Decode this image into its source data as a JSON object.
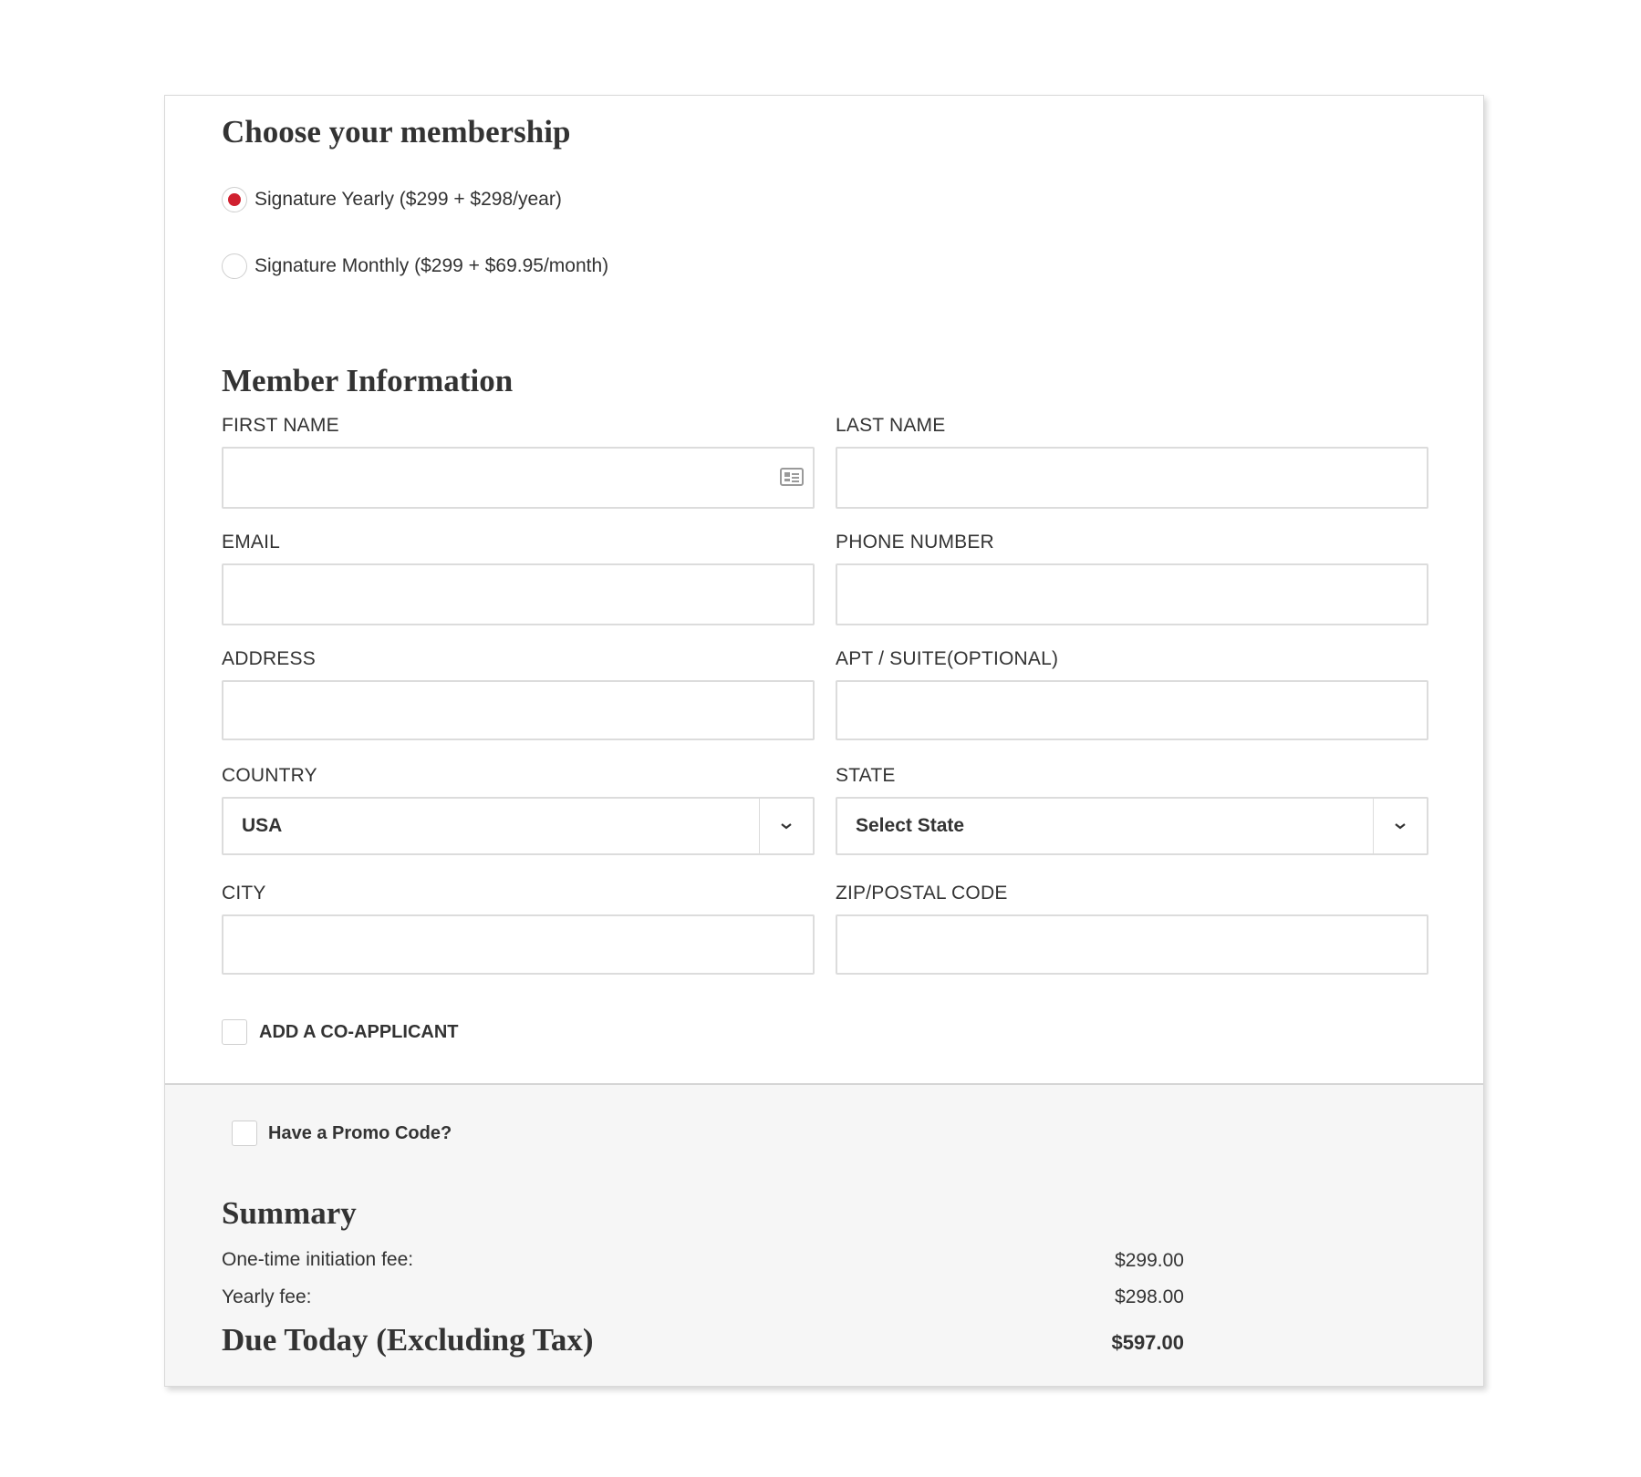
{
  "membership": {
    "heading": "Choose your membership",
    "options": [
      {
        "label": "Signature Yearly ($299 + $298/year)",
        "selected": true
      },
      {
        "label": "Signature Monthly ($299 + $69.95/month)",
        "selected": false
      }
    ],
    "accent_color": "#d0202f"
  },
  "member_info": {
    "heading": "Member Information",
    "first_name": {
      "label": "FIRST NAME",
      "value": ""
    },
    "last_name": {
      "label": "LAST NAME",
      "value": ""
    },
    "email": {
      "label": "EMAIL",
      "value": ""
    },
    "phone": {
      "label": "PHONE NUMBER",
      "value": ""
    },
    "address": {
      "label": "ADDRESS",
      "value": ""
    },
    "apt": {
      "label": "APT / SUITE(OPTIONAL)",
      "value": ""
    },
    "country": {
      "label": "COUNTRY",
      "selected": "USA"
    },
    "state": {
      "label": "STATE",
      "selected": "Select State"
    },
    "city": {
      "label": "CITY",
      "value": ""
    },
    "zip": {
      "label": "ZIP/POSTAL CODE",
      "value": ""
    },
    "co_applicant": {
      "label": "ADD A CO-APPLICANT",
      "checked": false
    }
  },
  "promo": {
    "label": "Have a Promo Code?",
    "checked": false
  },
  "summary": {
    "heading": "Summary",
    "initiation_label": "One-time initiation fee:",
    "initiation_amount": "$299.00",
    "yearly_label": "Yearly fee:",
    "yearly_amount": "$298.00",
    "due_label": "Due Today (Excluding Tax)",
    "due_amount": "$597.00"
  },
  "icons": {
    "contact_card": "contact-card-icon",
    "chevron": "chevron-down-icon"
  }
}
